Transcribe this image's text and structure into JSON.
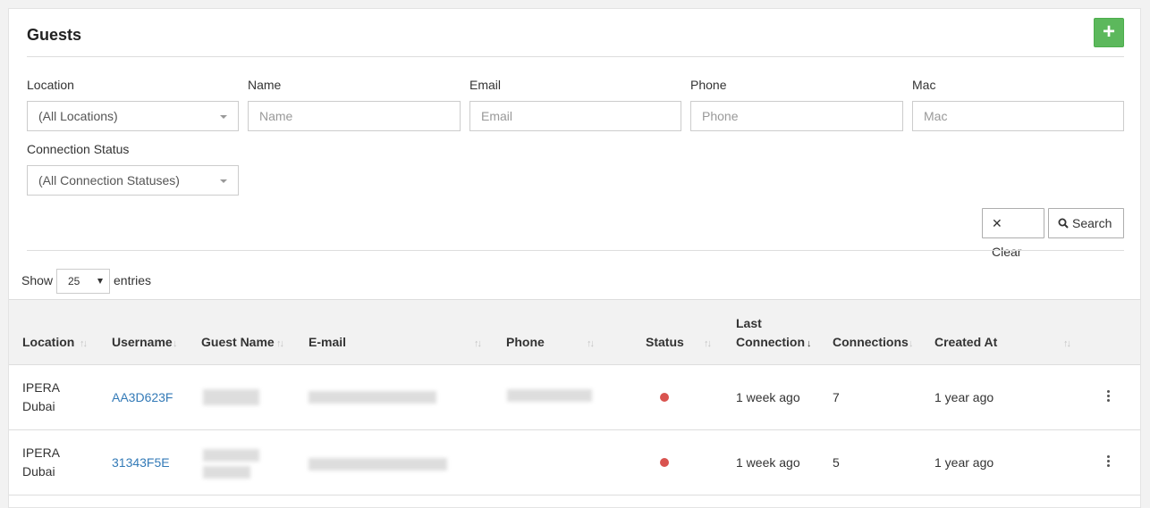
{
  "header": {
    "title": "Guests",
    "add_icon": "+"
  },
  "filters": {
    "location": {
      "label": "Location",
      "value": "(All Locations)"
    },
    "name": {
      "label": "Name",
      "placeholder": "Name"
    },
    "email": {
      "label": "Email",
      "placeholder": "Email"
    },
    "phone": {
      "label": "Phone",
      "placeholder": "Phone"
    },
    "mac": {
      "label": "Mac",
      "placeholder": "Mac"
    },
    "connection_status": {
      "label": "Connection Status",
      "value": "(All Connection Statuses)"
    },
    "clear_label": "Clear",
    "search_label": "Search"
  },
  "length": {
    "show": "Show",
    "value": "25",
    "entries": "entries"
  },
  "columns": {
    "location": "Location",
    "username": "Username",
    "guest_name": "Guest Name",
    "email": "E-mail",
    "phone": "Phone",
    "status": "Status",
    "last_connection_1": "Last",
    "last_connection_2": "Connection",
    "connections": "Connections",
    "created_at": "Created At"
  },
  "rows": [
    {
      "location_1": "IPERA",
      "location_2": "Dubai",
      "username": "AA3D623F",
      "status_color": "#d9534f",
      "last_connection": "1 week ago",
      "connections": "7",
      "created_at": "1 year ago"
    },
    {
      "location_1": "IPERA",
      "location_2": "Dubai",
      "username": "31343F5E",
      "status_color": "#d9534f",
      "last_connection": "1 week ago",
      "connections": "5",
      "created_at": "1 year ago"
    }
  ]
}
